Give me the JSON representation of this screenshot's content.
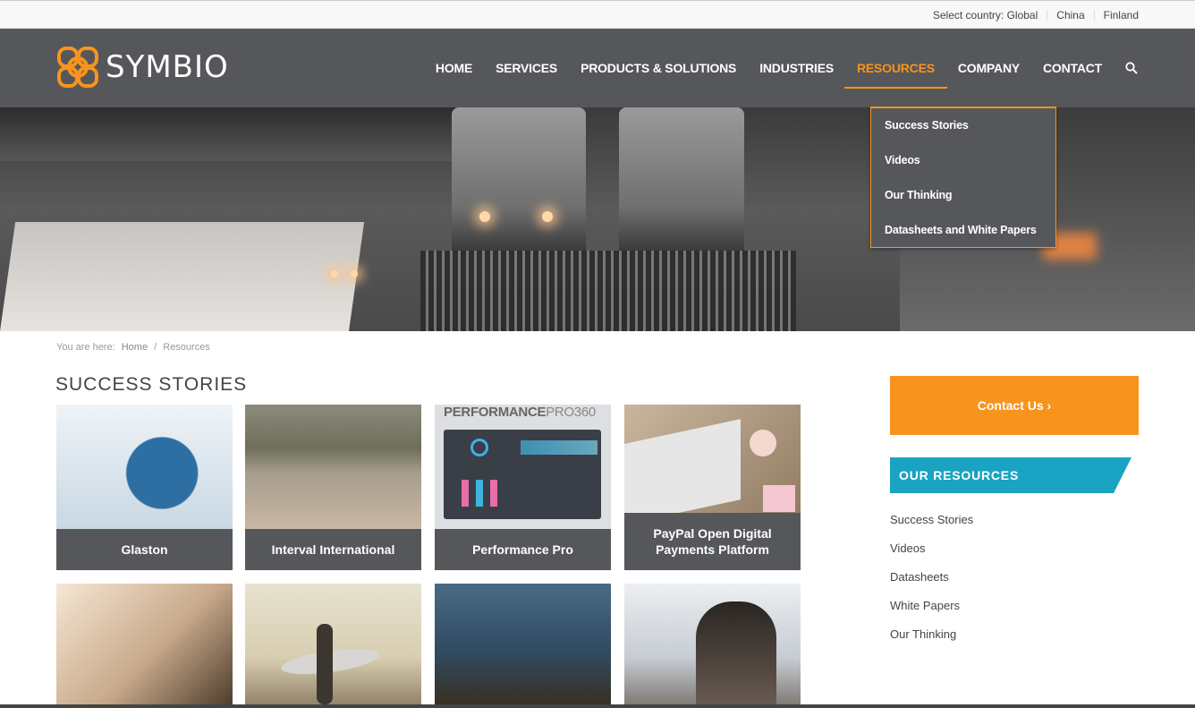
{
  "topbar": {
    "select_country": "Select country: Global",
    "china": "China",
    "finland": "Finland"
  },
  "brand": {
    "name": "SYMBIO",
    "accent_color": "#f7941d",
    "teal_color": "#1aa3c2",
    "header_bg": "#55575a"
  },
  "nav": {
    "items": [
      {
        "label": "HOME"
      },
      {
        "label": "SERVICES"
      },
      {
        "label": "PRODUCTS & SOLUTIONS"
      },
      {
        "label": "INDUSTRIES"
      },
      {
        "label": "RESOURCES"
      },
      {
        "label": "COMPANY"
      },
      {
        "label": "CONTACT"
      }
    ],
    "active": "RESOURCES",
    "search_icon": "search-icon"
  },
  "dropdown": {
    "items": [
      {
        "label": "Success Stories"
      },
      {
        "label": "Videos"
      },
      {
        "label": "Our Thinking"
      },
      {
        "label": "Datasheets and White Papers"
      }
    ]
  },
  "breadcrumb": {
    "prefix": "You are here:",
    "home": "Home",
    "separator": "/",
    "current": "Resources"
  },
  "main": {
    "section_title": "SUCCESS STORIES",
    "cards": [
      {
        "label": "Glaston"
      },
      {
        "label": "Interval International"
      },
      {
        "label": "Performance Pro"
      },
      {
        "label": "PayPal Open Digital Payments Platform"
      }
    ],
    "performance_logo_a": "PERFORMANCE",
    "performance_logo_b": "PRO360"
  },
  "sidebar": {
    "contact_button": "Contact Us ›",
    "resources_title": "OUR RESOURCES",
    "resources": [
      {
        "label": "Success Stories"
      },
      {
        "label": "Videos"
      },
      {
        "label": "Datasheets"
      },
      {
        "label": "White Papers"
      },
      {
        "label": "Our Thinking"
      }
    ]
  }
}
